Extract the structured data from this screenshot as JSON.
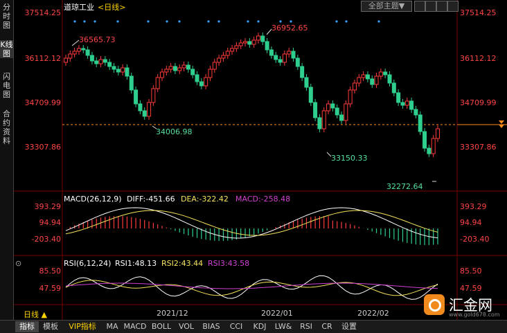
{
  "left_tabs": [
    "分时图",
    "K线图",
    "闪电图",
    "合约资料"
  ],
  "header": {
    "title": "道琼工业",
    "period": "<日线>",
    "theme_button": "全部主题▼"
  },
  "price_axis": [
    "37514.25",
    "36112.12",
    "34709.99",
    "33307.86"
  ],
  "annotations": {
    "high1": "36565.73",
    "high2": "36952.65",
    "low1": "34006.98",
    "low2": "33150.33",
    "low3": "32272.64"
  },
  "macd": {
    "title": "MACD(26,12,9)",
    "diff": "DIFF:-451.66",
    "dea": "DEA:-322.42",
    "macd": "MACD:-258.48",
    "axis": [
      "393.29",
      "94.94",
      "-203.40"
    ]
  },
  "rsi": {
    "title": "RSI(6,12,24)",
    "rsi1": "RSI1:48.13",
    "rsi2": "RSI2:43.44",
    "rsi3": "RSI3:43.58",
    "axis": [
      "85.50",
      "47.59"
    ]
  },
  "time_axis": [
    "2021/12",
    "2022/01",
    "2022/02"
  ],
  "period_button": "日线 ▲",
  "watermark": {
    "name": "汇金网",
    "url": "www.gold678.com"
  },
  "bottom_tabs": [
    "指标",
    "模板",
    "VIP指标",
    "MA",
    "MACD",
    "BOLL",
    "VOL",
    "BIAS",
    "CCI",
    "KDJ",
    "LW&",
    "RSI",
    "CR",
    "设置"
  ],
  "colors": {
    "up": "#ff3b3b",
    "down": "#2ecf8e",
    "macd_diff": "#ffffff",
    "macd_dea": "#f5e35c",
    "rsi3": "#d040d0",
    "grid": "#7a0000"
  }
}
